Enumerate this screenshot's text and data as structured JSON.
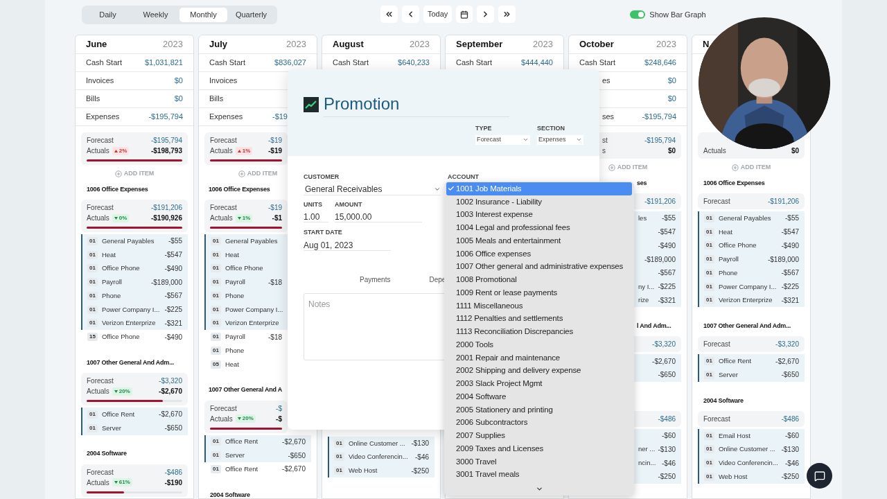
{
  "period_tabs": [
    {
      "label": "Daily",
      "selected": false
    },
    {
      "label": "Weekly",
      "selected": false
    },
    {
      "label": "Monthly",
      "selected": true
    },
    {
      "label": "Quarterly",
      "selected": false
    }
  ],
  "nav": [
    {
      "kind": "first"
    },
    {
      "kind": "prev"
    },
    {
      "kind": "today",
      "label": "Today"
    },
    {
      "kind": "calendar"
    },
    {
      "kind": "next"
    },
    {
      "kind": "last"
    }
  ],
  "bar_graph_toggle": {
    "label": "Show Bar Graph",
    "on": true
  },
  "columns": [
    {
      "month": "June",
      "year": "2023",
      "summary": [
        {
          "label": "Cash Start",
          "value": "$1,031,821"
        },
        {
          "label": "Invoices",
          "value": "$0"
        },
        {
          "label": "Bills",
          "value": "$0"
        },
        {
          "label": "Expenses",
          "value": "-$195,794"
        }
      ],
      "total": {
        "forecast_label": "Forecast",
        "forecast": "-$195,794",
        "actuals_label": "Actuals",
        "actuals": "-$198,793",
        "badge": {
          "text": "2%",
          "rising": true
        },
        "level": 1
      },
      "add_item": "ADD ITEM",
      "groups": [
        {
          "title": "1006 Office Expenses",
          "forecast_label": "Forecast",
          "forecast": "-$191,206",
          "actuals_label": "Actuals",
          "actuals": "-$190,926",
          "badge": {
            "text": "0%",
            "rising": false
          },
          "level": 1,
          "items": [
            {
              "code": "01",
              "name": "General Payables",
              "amount": "-$55",
              "grouped": true
            },
            {
              "code": "01",
              "name": "Heat",
              "amount": "-$547",
              "grouped": true
            },
            {
              "code": "01",
              "name": "Office Phone",
              "amount": "-$490",
              "grouped": true
            },
            {
              "code": "01",
              "name": "Payroll",
              "amount": "-$189,000",
              "grouped": true
            },
            {
              "code": "01",
              "name": "Phone",
              "amount": "-$567",
              "grouped": true
            },
            {
              "code": "01",
              "name": "Power Company I...",
              "amount": "-$225",
              "grouped": true
            },
            {
              "code": "01",
              "name": "Verizon Enterprize",
              "amount": "-$321",
              "grouped": true
            },
            {
              "code": "15",
              "name": "Office Phone",
              "amount": "-$490",
              "grouped": false
            }
          ]
        },
        {
          "title": "1007 Other General And Adm...",
          "forecast_label": "Forecast",
          "forecast": "-$3,320",
          "actuals_label": "Actuals",
          "actuals": "-$2,670",
          "badge": {
            "text": "20%",
            "rising": false
          },
          "level": 0.8,
          "items": [
            {
              "code": "01",
              "name": "Office Rent",
              "amount": "-$2,670",
              "grouped": true
            },
            {
              "code": "01",
              "name": "Server",
              "amount": "-$650",
              "grouped": true
            }
          ]
        },
        {
          "title": "2004 Software",
          "forecast_label": "Forecast",
          "forecast": "-$486",
          "actuals_label": "Actuals",
          "actuals": "-$190",
          "badge": {
            "text": "61%",
            "rising": false
          },
          "level": 0.39
        }
      ]
    },
    {
      "month": "July",
      "year": "2023",
      "summary": [
        {
          "label": "Cash Start",
          "value": "$836,027"
        },
        {
          "label": "Invoices"
        },
        {
          "label": "Bills"
        },
        {
          "label": "Expenses",
          "value": "-$19"
        }
      ],
      "total": {
        "forecast_label": "Forecast",
        "forecast": "-$19",
        "actuals_label": "Actuals",
        "actuals": "-$19",
        "badge": {
          "text": "1%",
          "rising": true
        },
        "level": 1
      },
      "add_item": "ADD ITEM",
      "groups": [
        {
          "title": "1006 Office Expenses",
          "forecast_label": "Forecast",
          "forecast": "-$19",
          "actuals_label": "Actuals",
          "actuals": "-$1",
          "badge": {
            "text": "1%",
            "rising": false
          },
          "level": 1,
          "items": [
            {
              "code": "01",
              "name": "General Payables",
              "grouped": true
            },
            {
              "code": "01",
              "name": "Heat",
              "grouped": true
            },
            {
              "code": "01",
              "name": "Office Phone",
              "grouped": true
            },
            {
              "code": "01",
              "name": "Payroll",
              "amount": "-$18",
              "grouped": true
            },
            {
              "code": "01",
              "name": "Phone",
              "grouped": true
            },
            {
              "code": "01",
              "name": "Power Company I...",
              "grouped": true
            },
            {
              "code": "01",
              "name": "Verizon Enterprize",
              "grouped": true
            },
            {
              "code": "01",
              "name": "Payroll",
              "amount": "-$18",
              "grouped": false
            },
            {
              "code": "01",
              "name": "Phone",
              "grouped": false
            },
            {
              "code": "05",
              "name": "Heat",
              "grouped": false
            }
          ]
        },
        {
          "title": "1007 Other General And A",
          "forecast_label": "Forecast",
          "forecast": "-$",
          "actuals_label": "Actuals",
          "actuals": "-$",
          "badge": {
            "text": "20%",
            "rising": false
          },
          "level": 1,
          "items": [
            {
              "code": "01",
              "name": "Office Rent",
              "amount": "-$2,670",
              "grouped": true
            },
            {
              "code": "01",
              "name": "Server",
              "amount": "-$650",
              "grouped": true
            },
            {
              "code": "01",
              "name": "Office Rent",
              "amount": "-$2,670",
              "grouped": false
            }
          ]
        },
        {
          "title": "2004 Software"
        }
      ]
    },
    {
      "month": "August",
      "year": "2023",
      "summary": [
        {
          "label": "Cash Start",
          "value": "$640,233"
        }
      ],
      "groups": [
        {
          "items": [
            {
              "code": "01",
              "name": "Online Customer ...",
              "amount": "-$130",
              "grouped": true
            },
            {
              "code": "01",
              "name": "Video Conferencin...",
              "amount": "-$46",
              "grouped": true
            },
            {
              "code": "01",
              "name": "Web Host",
              "amount": "-$250",
              "grouped": true
            }
          ]
        }
      ]
    },
    {
      "month": "September",
      "year": "2023",
      "summary": [
        {
          "label": "Cash Start",
          "value": "$444,440"
        }
      ]
    },
    {
      "month": "October",
      "year": "2023",
      "summary": [
        {
          "label": "Cash Start",
          "value": "$248,646"
        },
        {
          "label": "es",
          "value": "$0"
        },
        {
          "value": "$0"
        },
        {
          "label": "ses",
          "value": "-$195,794"
        }
      ],
      "total": {
        "forecast_label": "st",
        "forecast": "-$195,794",
        "actuals_label": "s",
        "actuals": "$0"
      },
      "add_item": "ADD ITEM",
      "groups": [
        {
          "title": "ses",
          "forecast": "-$191,206",
          "items": [
            {
              "name": "les",
              "amount": "-$55",
              "grouped": true
            },
            {
              "amount": "-$547",
              "grouped": true
            },
            {
              "amount": "-$490",
              "grouped": true
            },
            {
              "amount": "-$189,000",
              "grouped": true
            },
            {
              "amount": "-$567",
              "grouped": true
            },
            {
              "name": "ny I...",
              "amount": "-$225",
              "grouped": true
            },
            {
              "name": "rize",
              "amount": "-$321",
              "grouped": true
            }
          ]
        },
        {
          "title": "l And Adm...",
          "forecast": "-$3,320",
          "items": [
            {
              "amount": "-$2,670",
              "grouped": true
            },
            {
              "amount": "-$650",
              "grouped": true
            }
          ]
        },
        {
          "forecast": "-$486",
          "items": [
            {
              "amount": "-$60",
              "grouped": true
            },
            {
              "name": "ner ...",
              "amount": "-$130",
              "grouped": true
            },
            {
              "name": "ncin...",
              "amount": "-$46",
              "grouped": true
            },
            {
              "amount": "-$250",
              "grouped": true
            }
          ]
        }
      ]
    },
    {
      "month": "N",
      "total": {
        "actuals_label": "Actuals",
        "actuals": "$0"
      },
      "add_item": "ADD ITEM",
      "groups": [
        {
          "title": "1006 Office Expenses",
          "forecast_label": "Forecast",
          "forecast": "-$191,206",
          "items": [
            {
              "code": "01",
              "name": "General Payables",
              "amount": "-$55",
              "grouped": true
            },
            {
              "code": "01",
              "name": "Heat",
              "amount": "-$547",
              "grouped": true
            },
            {
              "code": "01",
              "name": "Office Phone",
              "amount": "-$490",
              "grouped": true
            },
            {
              "code": "01",
              "name": "Payroll",
              "amount": "-$189,000",
              "grouped": true
            },
            {
              "code": "01",
              "name": "Phone",
              "amount": "-$567",
              "grouped": true
            },
            {
              "code": "01",
              "name": "Power Company I...",
              "amount": "-$225",
              "grouped": true
            },
            {
              "code": "01",
              "name": "Verizon Enterprize",
              "amount": "-$321",
              "grouped": true
            }
          ]
        },
        {
          "title": "1007 Other General And Adm...",
          "forecast_label": "Forecast",
          "forecast": "-$3,320",
          "items": [
            {
              "code": "01",
              "name": "Office Rent",
              "amount": "-$2,670",
              "grouped": true
            },
            {
              "code": "01",
              "name": "Server",
              "amount": "-$650",
              "grouped": true
            }
          ]
        },
        {
          "title": "2004 Software",
          "forecast_label": "Forecast",
          "forecast": "-$486",
          "items": [
            {
              "code": "01",
              "name": "Email Host",
              "amount": "-$60",
              "grouped": true
            },
            {
              "code": "01",
              "name": "Online Customer ...",
              "amount": "-$130",
              "grouped": true
            },
            {
              "code": "01",
              "name": "Video Conferencin...",
              "amount": "-$46",
              "grouped": true
            },
            {
              "code": "01",
              "name": "Web Host",
              "amount": "-$250",
              "grouped": true
            }
          ]
        }
      ]
    }
  ],
  "modal": {
    "title": "Promotion",
    "type": {
      "label": "TYPE",
      "value": "Forecast"
    },
    "section": {
      "label": "SECTION",
      "value": "Expenses"
    },
    "customer": {
      "label": "CUSTOMER",
      "value": "General Receivables"
    },
    "account": {
      "label": "ACCOUNT"
    },
    "units": {
      "label": "UNITS",
      "value": "1.00"
    },
    "amount": {
      "label": "AMOUNT",
      "value": "15,000.00"
    },
    "start_date": {
      "label": "START DATE",
      "value": "Aug 01, 2023"
    },
    "tabs": [
      {
        "label": "Payments",
        "selected": false
      },
      {
        "label": "Depe",
        "selected": false
      }
    ],
    "notes": {
      "placeholder": "Notes"
    }
  },
  "account_menu": {
    "options": [
      {
        "label": "1001 Job Materials",
        "selected": true
      },
      {
        "label": "1002 Insurance - Liability",
        "selected": false
      },
      {
        "label": "1003 Interest expense",
        "selected": false
      },
      {
        "label": "1004 Legal and professional fees",
        "selected": false
      },
      {
        "label": "1005 Meals and entertainment",
        "selected": false
      },
      {
        "label": "1006 Office expenses",
        "selected": false
      },
      {
        "label": "1007 Other general and administrative expenses",
        "selected": false
      },
      {
        "label": "1008 Promotional",
        "selected": false
      },
      {
        "label": "1009 Rent or lease payments",
        "selected": false
      },
      {
        "label": "1111 Miscellaneous",
        "selected": false
      },
      {
        "label": "1112 Penalties and settlements",
        "selected": false
      },
      {
        "label": "1113 Reconciliation Discrepancies",
        "selected": false
      },
      {
        "label": "2000 Tools",
        "selected": false
      },
      {
        "label": "2001 Repair and maintenance",
        "selected": false
      },
      {
        "label": "2002 Shipping and delivery expense",
        "selected": false
      },
      {
        "label": "2003 Slack Project Mgmt",
        "selected": false
      },
      {
        "label": "2004 Software",
        "selected": false
      },
      {
        "label": "2005 Stationery and printing",
        "selected": false
      },
      {
        "label": "2006 Subcontractors",
        "selected": false
      },
      {
        "label": "2007 Supplies",
        "selected": false
      },
      {
        "label": "2009 Taxes and Licenses",
        "selected": false
      },
      {
        "label": "3000 Travel",
        "selected": false
      },
      {
        "label": "3001 Travel meals",
        "selected": false
      }
    ]
  }
}
